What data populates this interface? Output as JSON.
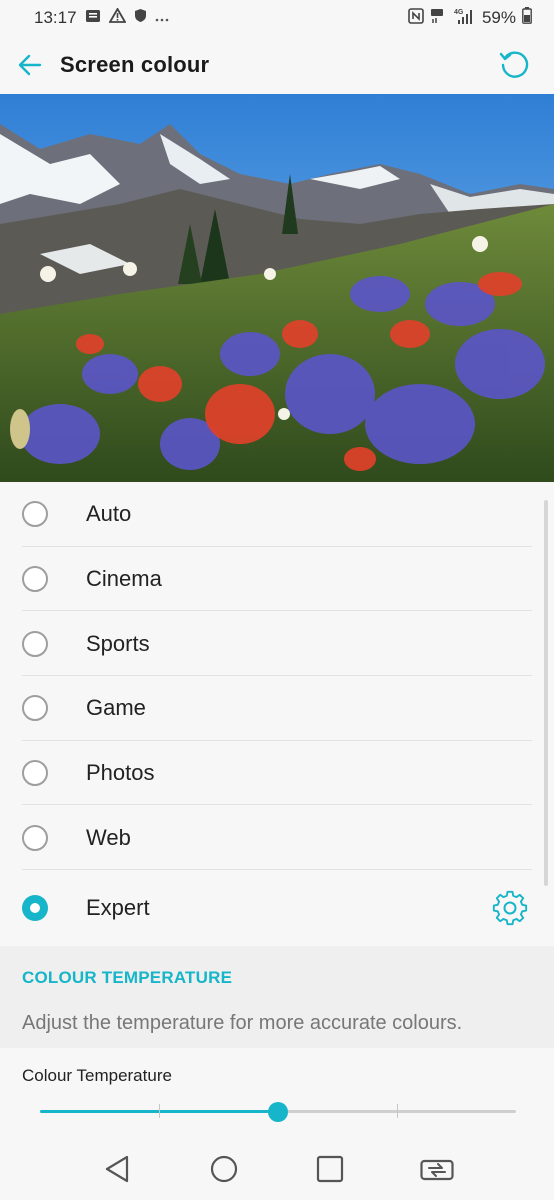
{
  "status_bar": {
    "time": "13:17",
    "battery": "59%",
    "network": "4G"
  },
  "app_bar": {
    "title": "Screen colour"
  },
  "options": [
    {
      "label": "Auto",
      "selected": false
    },
    {
      "label": "Cinema",
      "selected": false
    },
    {
      "label": "Sports",
      "selected": false
    },
    {
      "label": "Game",
      "selected": false
    },
    {
      "label": "Photos",
      "selected": false
    },
    {
      "label": "Web",
      "selected": false
    },
    {
      "label": "Expert",
      "selected": true
    }
  ],
  "colour_temperature": {
    "section_header": "COLOUR TEMPERATURE",
    "description": "Adjust the temperature for more accurate colours.",
    "slider_label": "Colour Temperature",
    "slider_value": 0.5,
    "slider_steps": 4
  },
  "theme": {
    "accent": "#16b5c9"
  },
  "icons": {
    "back": "arrow-left-icon",
    "reset": "reset-icon",
    "settings": "gear-icon",
    "nav_back": "triangle-back-icon",
    "nav_home": "circle-home-icon",
    "nav_recents": "square-recents-icon",
    "nav_switch": "dual-window-icon"
  }
}
